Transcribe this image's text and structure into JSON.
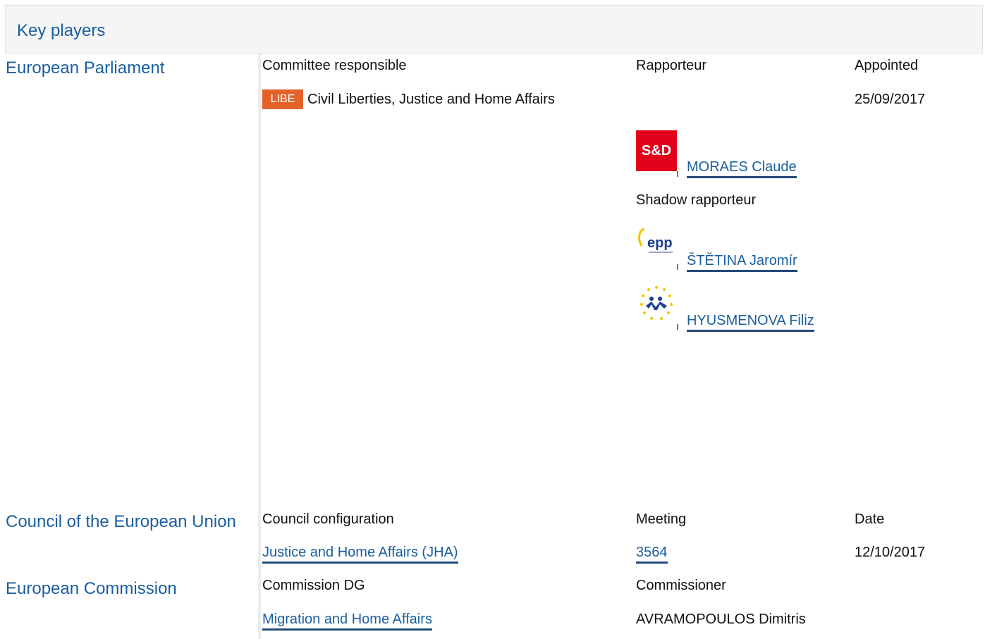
{
  "header": {
    "title": "Key players"
  },
  "ep": {
    "name": "European Parliament",
    "col_committee": "Committee responsible",
    "col_rapporteur": "Rapporteur",
    "col_appointed": "Appointed",
    "committee_badge": "LIBE",
    "committee_name": "Civil Liberties, Justice and Home Affairs",
    "appointed_date": "25/09/2017",
    "rapporteur": {
      "group_logo": "S&D",
      "name": "MORAES Claude"
    },
    "shadow_label": "Shadow rapporteur",
    "shadows": [
      {
        "group_logo": "epp",
        "name": "ŠTĚTINA Jaromír"
      },
      {
        "group_logo": "alde",
        "name": "HYUSMENOVA Filiz"
      }
    ]
  },
  "council": {
    "name": "Council of the European Union",
    "col_config": "Council configuration",
    "col_meeting": "Meeting",
    "col_date": "Date",
    "config": "Justice and Home Affairs (JHA)",
    "meeting": "3564",
    "date": "12/10/2017"
  },
  "commission": {
    "name": "European Commission",
    "col_dg": "Commission DG",
    "col_commissioner": "Commissioner",
    "dg": "Migration and Home Affairs",
    "commissioner": "AVRAMOPOULOS Dimitris"
  },
  "colors": {
    "link": "#1a5ea0",
    "badge": "#e2622a",
    "sd_red": "#e2001a"
  }
}
